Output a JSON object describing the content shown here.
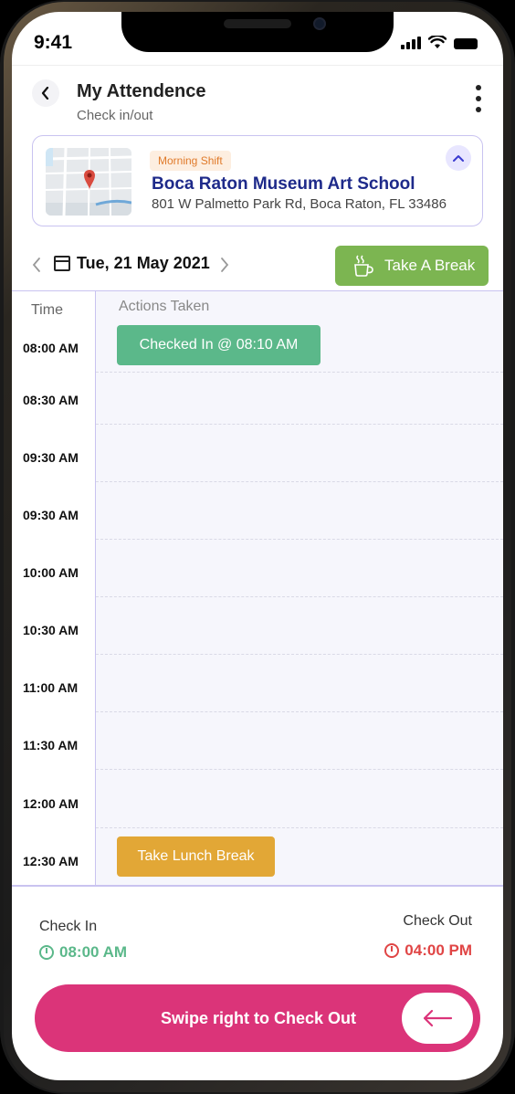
{
  "status_bar": {
    "time": "9:41"
  },
  "header": {
    "title": "My Attendence",
    "subtitle": "Check in/out"
  },
  "location": {
    "shift_badge": "Morning Shift",
    "name": "Boca Raton Museum Art School",
    "address": "801 W Palmetto Park Rd, Boca Raton, FL 33486"
  },
  "date_nav": {
    "date": "Tue, 21 May 2021",
    "break_label": "Take A Break"
  },
  "schedule": {
    "time_header": "Time",
    "actions_header": "Actions Taken",
    "times": [
      "08:00  AM",
      "08:30  AM",
      "09:30  AM",
      "09:30  AM",
      "10:00  AM",
      "10:30  AM",
      "11:00  AM",
      "11:30  AM",
      "12:00  AM",
      "12:30  AM"
    ],
    "checked_in_chip": "Checked In @ 08:10 AM",
    "lunch_chip": "Take Lunch Break"
  },
  "summary": {
    "check_in_label": "Check In",
    "check_in_time": "08:00 AM",
    "check_out_label": "Check Out",
    "check_out_time": "04:00 PM"
  },
  "swipe": {
    "label": "Swipe right to Check Out"
  },
  "colors": {
    "accent": "#db3479",
    "checkin_green": "#5bb88a",
    "break_green": "#7cb551",
    "lunch_orange": "#e2a736",
    "checkout_red": "#e04545",
    "location_name": "#1e2a8a"
  }
}
